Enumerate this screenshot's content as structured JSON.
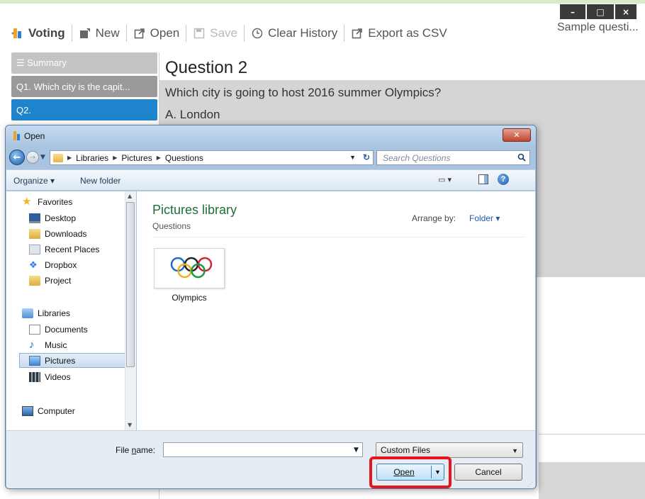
{
  "app": {
    "toolbar": {
      "title": "Voting",
      "new_label": "New",
      "open_label": "Open",
      "save_label": "Save",
      "clear_label": "Clear History",
      "export_label": "Export as CSV"
    },
    "window_controls": {
      "minimize": "–",
      "maximize": "□",
      "close": "×"
    },
    "sample_label": "Sample questi..."
  },
  "sidebar": {
    "items": [
      {
        "label": "☰ Summary"
      },
      {
        "label": "Q1. Which city is the capit..."
      },
      {
        "label": "Q2."
      }
    ]
  },
  "question": {
    "title": "Question 2",
    "text": "Which city is going to host 2016 summer Olympics?",
    "answer_a": "A. London"
  },
  "dialog": {
    "title": "Open",
    "close_symbol": "✕",
    "address": {
      "crumbs": [
        "Libraries",
        "Pictures",
        "Questions"
      ]
    },
    "search_placeholder": "Search Questions",
    "commands": {
      "organize": "Organize ▾",
      "new_folder": "New folder"
    },
    "nav": {
      "favorites_header": "Favorites",
      "favorites": [
        "Desktop",
        "Downloads",
        "Recent Places",
        "Dropbox",
        "Project"
      ],
      "libraries_header": "Libraries",
      "libraries": [
        "Documents",
        "Music",
        "Pictures",
        "Videos"
      ],
      "computer": "Computer"
    },
    "content": {
      "library_title": "Pictures library",
      "library_sub": "Questions",
      "arrange_label": "Arrange by:",
      "arrange_value": "Folder ▾",
      "files": [
        {
          "name": "Olympics"
        }
      ]
    },
    "file_name_label": "File name:",
    "file_name_value": "",
    "filter_value": "Custom Files",
    "open_button": "Open",
    "cancel_button": "Cancel"
  },
  "colors": {
    "accent_blue": "#1f84cc",
    "highlight_red": "#e4151d",
    "library_green": "#1e6f38"
  }
}
